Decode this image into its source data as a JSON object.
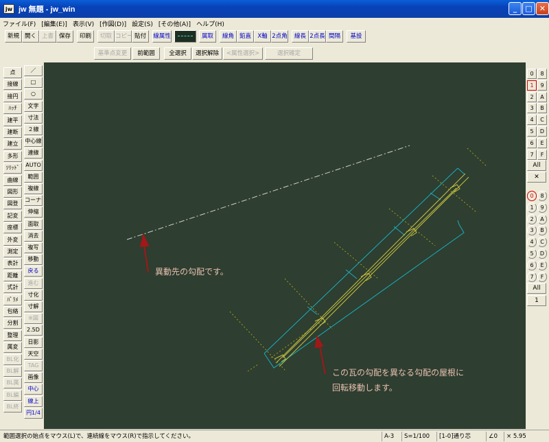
{
  "window": {
    "app_icon": "jw",
    "title": "jw 無題 - jw_win",
    "btn_min": "_",
    "btn_max": "□",
    "btn_close": "✕"
  },
  "menu": [
    "ファイル(F)",
    "[編集(E)]",
    "表示(V)",
    "[作図(D)]",
    "設定(S)",
    "[その他(A)]",
    "ヘルプ(H)"
  ],
  "toolbar1": [
    "新規",
    "開く",
    "上書",
    "保存",
    "印刷",
    "切取",
    "コピー",
    "貼付",
    "線属性",
    "",
    "属取",
    "線角",
    "鉛直",
    "X軸",
    "2点角",
    "線長",
    "2点長",
    "間隔",
    "基設"
  ],
  "toolbar2": [
    "基準点変更",
    "前範囲",
    "全選択",
    "選択解除",
    "<属性選択>",
    "選択確定"
  ],
  "left_col1": [
    "点",
    "接線",
    "接円",
    "ﾊｯﾁ",
    "建平",
    "建断",
    "建立",
    "多形",
    "ｿﾘｯﾄﾞ",
    "曲線",
    "図形",
    "図登",
    "記変",
    "座標",
    "外変",
    "測定",
    "表計",
    "距離",
    "式計",
    "ﾊﾟﾗﾒ",
    "包絡",
    "分割",
    "整理",
    "属変",
    "BL化",
    "BL解",
    "BL属",
    "BL編",
    "BL終"
  ],
  "left_col2": [
    "／",
    "□",
    "○",
    "文字",
    "寸法",
    "２線",
    "中心線",
    "連線",
    "AUTO",
    "範囲",
    "複線",
    "コーナー",
    "伸縮",
    "面取",
    "消去",
    "複写",
    "移動",
    "戻る",
    "進む",
    "寸化",
    "寸解",
    "※図",
    "2.5D",
    "日影",
    "天空",
    "TAG",
    "画像",
    "中心",
    "線上",
    "円1/4"
  ],
  "canvas": {
    "annotation1": "異動先の勾配です。",
    "annotation2_line1": "この瓦の勾配を異なる勾配の屋根に",
    "annotation2_line2": "回転移動します。",
    "colors": {
      "background": "#2e3e30",
      "roof": "#18b0c0",
      "tile": "#c8c040",
      "guide": "#a0a020",
      "target": "#d0d0d0",
      "arrow": "#a01818"
    }
  },
  "layers": [
    "0",
    "8",
    "1",
    "9",
    "2",
    "A",
    "3",
    "B",
    "4",
    "C",
    "5",
    "D",
    "6",
    "E",
    "7",
    "F"
  ],
  "layers_all": "All",
  "layers_x": "✕",
  "groups": [
    "0",
    "8",
    "1",
    "9",
    "2",
    "A",
    "3",
    "B",
    "4",
    "C",
    "5",
    "D",
    "6",
    "E",
    "7",
    "F"
  ],
  "groups_all": "All",
  "groups_one": "1",
  "status": {
    "message": "範囲選択の始点をマウス(L)で、連続線をマウス(R)で指示してください。",
    "paper": "A-3",
    "scale": "S=1/100",
    "layer": "[1-0]通り芯",
    "angle": "∠0",
    "zoom": "× 5.95"
  }
}
